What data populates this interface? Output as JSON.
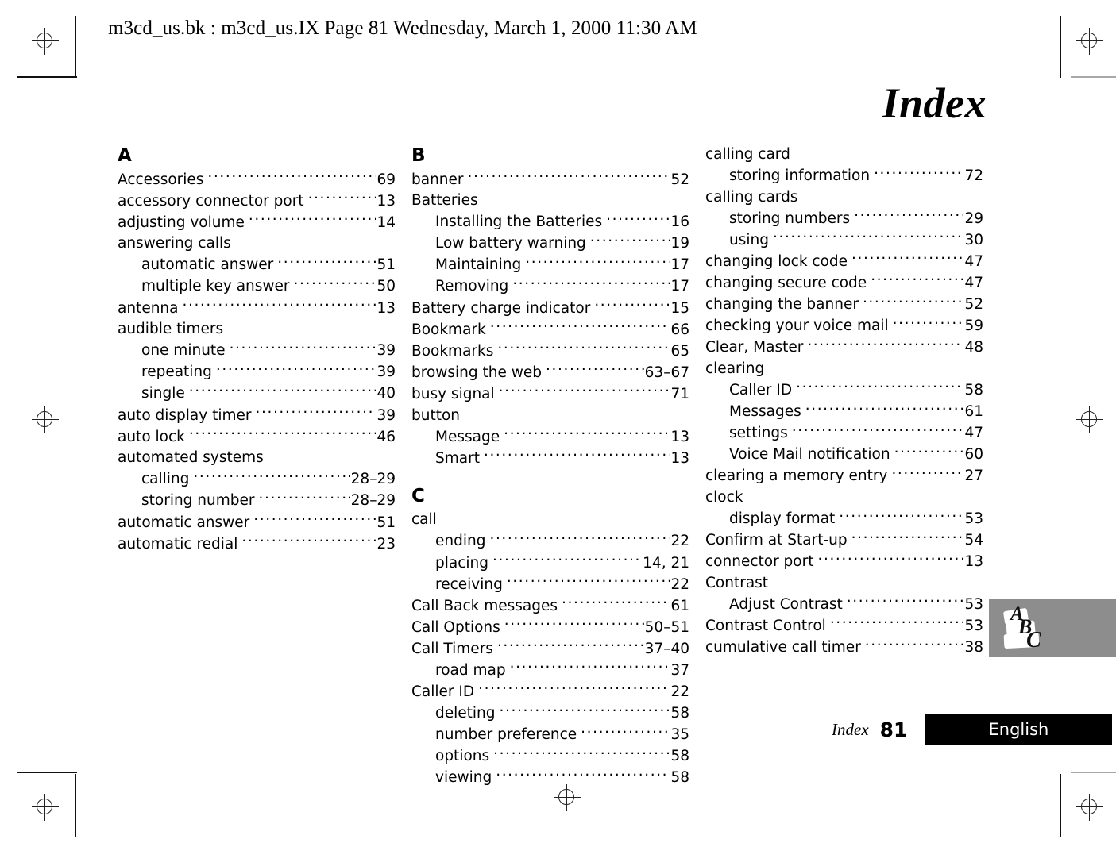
{
  "header": {
    "running_head": "m3cd_us.bk : m3cd_us.IX  Page 81  Wednesday, March 1, 2000  11:30 AM"
  },
  "chapter": {
    "title": "Index"
  },
  "footer": {
    "label": "Index",
    "page_number": "81",
    "language": "English"
  },
  "thumb_tab": {
    "letters": [
      "A",
      "B",
      "C"
    ],
    "background_color": "#8d8d8d"
  },
  "columns": [
    {
      "id": "column-1",
      "blocks": [
        {
          "type": "letter",
          "label": "A"
        },
        {
          "type": "entry",
          "level": 0,
          "term": "Accessories",
          "page": "69"
        },
        {
          "type": "entry",
          "level": 0,
          "term": "accessory connector port",
          "page": "13"
        },
        {
          "type": "entry",
          "level": 0,
          "term": "adjusting volume",
          "page": "14"
        },
        {
          "type": "entry",
          "level": 0,
          "term": "answering calls",
          "page": ""
        },
        {
          "type": "entry",
          "level": 1,
          "term": "automatic answer",
          "page": "51"
        },
        {
          "type": "entry",
          "level": 1,
          "term": "multiple key answer",
          "page": "50"
        },
        {
          "type": "entry",
          "level": 0,
          "term": "antenna",
          "page": "13"
        },
        {
          "type": "entry",
          "level": 0,
          "term": "audible timers",
          "page": ""
        },
        {
          "type": "entry",
          "level": 1,
          "term": "one minute",
          "page": "39"
        },
        {
          "type": "entry",
          "level": 1,
          "term": "repeating",
          "page": "39"
        },
        {
          "type": "entry",
          "level": 1,
          "term": "single",
          "page": "40"
        },
        {
          "type": "entry",
          "level": 0,
          "term": "auto display timer",
          "page": "39"
        },
        {
          "type": "entry",
          "level": 0,
          "term": "auto lock",
          "page": "46"
        },
        {
          "type": "entry",
          "level": 0,
          "term": "automated systems",
          "page": ""
        },
        {
          "type": "entry",
          "level": 1,
          "term": "calling",
          "page": "28–29"
        },
        {
          "type": "entry",
          "level": 1,
          "term": "storing number",
          "page": "28–29"
        },
        {
          "type": "entry",
          "level": 0,
          "term": "automatic answer",
          "page": "51"
        },
        {
          "type": "entry",
          "level": 0,
          "term": "automatic redial",
          "page": "23"
        }
      ]
    },
    {
      "id": "column-2",
      "blocks": [
        {
          "type": "letter",
          "label": "B"
        },
        {
          "type": "entry",
          "level": 0,
          "term": "banner",
          "page": "52"
        },
        {
          "type": "entry",
          "level": 0,
          "term": "Batteries",
          "page": ""
        },
        {
          "type": "entry",
          "level": 1,
          "term": "Installing the Batteries",
          "page": "16"
        },
        {
          "type": "entry",
          "level": 1,
          "term": "Low battery warning",
          "page": "19"
        },
        {
          "type": "entry",
          "level": 1,
          "term": "Maintaining",
          "page": "17"
        },
        {
          "type": "entry",
          "level": 1,
          "term": "Removing",
          "page": "17"
        },
        {
          "type": "entry",
          "level": 0,
          "term": "Battery charge indicator",
          "page": "15"
        },
        {
          "type": "entry",
          "level": 0,
          "term": "Bookmark",
          "page": "66"
        },
        {
          "type": "entry",
          "level": 0,
          "term": "Bookmarks",
          "page": "65"
        },
        {
          "type": "entry",
          "level": 0,
          "term": "browsing the web",
          "page": "63–67"
        },
        {
          "type": "entry",
          "level": 0,
          "term": "busy signal",
          "page": "71"
        },
        {
          "type": "entry",
          "level": 0,
          "term": "button",
          "page": ""
        },
        {
          "type": "entry",
          "level": 1,
          "term": "Message",
          "page": "13"
        },
        {
          "type": "entry",
          "level": 1,
          "term": "Smart",
          "page": "13"
        },
        {
          "type": "letter",
          "label": "C",
          "spaced": true
        },
        {
          "type": "entry",
          "level": 0,
          "term": "call",
          "page": ""
        },
        {
          "type": "entry",
          "level": 1,
          "term": "ending",
          "page": "22"
        },
        {
          "type": "entry",
          "level": 1,
          "term": "placing",
          "page": "14, 21"
        },
        {
          "type": "entry",
          "level": 1,
          "term": "receiving",
          "page": "22"
        },
        {
          "type": "entry",
          "level": 0,
          "term": "Call Back messages",
          "page": "61"
        },
        {
          "type": "entry",
          "level": 0,
          "term": "Call Options",
          "page": "50–51"
        },
        {
          "type": "entry",
          "level": 0,
          "term": "Call Timers",
          "page": "37–40"
        },
        {
          "type": "entry",
          "level": 1,
          "term": "road map",
          "page": "37"
        },
        {
          "type": "entry",
          "level": 0,
          "term": "Caller ID",
          "page": "22"
        },
        {
          "type": "entry",
          "level": 1,
          "term": "deleting",
          "page": "58"
        },
        {
          "type": "entry",
          "level": 1,
          "term": "number preference",
          "page": "35"
        },
        {
          "type": "entry",
          "level": 1,
          "term": "options",
          "page": "58"
        },
        {
          "type": "entry",
          "level": 1,
          "term": "viewing",
          "page": "58"
        }
      ]
    },
    {
      "id": "column-3",
      "blocks": [
        {
          "type": "entry",
          "level": 0,
          "term": "calling card",
          "page": ""
        },
        {
          "type": "entry",
          "level": 1,
          "term": "storing information",
          "page": "72"
        },
        {
          "type": "entry",
          "level": 0,
          "term": "calling cards",
          "page": ""
        },
        {
          "type": "entry",
          "level": 1,
          "term": "storing numbers",
          "page": "29"
        },
        {
          "type": "entry",
          "level": 1,
          "term": "using",
          "page": "30"
        },
        {
          "type": "entry",
          "level": 0,
          "term": "changing lock code",
          "page": "47"
        },
        {
          "type": "entry",
          "level": 0,
          "term": "changing secure code",
          "page": "47"
        },
        {
          "type": "entry",
          "level": 0,
          "term": "changing the banner",
          "page": "52"
        },
        {
          "type": "entry",
          "level": 0,
          "term": "checking your voice mail",
          "page": "59"
        },
        {
          "type": "entry",
          "level": 0,
          "term": "Clear, Master",
          "page": "48"
        },
        {
          "type": "entry",
          "level": 0,
          "term": "clearing",
          "page": ""
        },
        {
          "type": "entry",
          "level": 1,
          "term": "Caller ID",
          "page": "58"
        },
        {
          "type": "entry",
          "level": 1,
          "term": "Messages",
          "page": "61"
        },
        {
          "type": "entry",
          "level": 1,
          "term": "settings",
          "page": "47"
        },
        {
          "type": "entry",
          "level": 1,
          "term": "Voice Mail notification",
          "page": "60"
        },
        {
          "type": "entry",
          "level": 0,
          "term": "clearing a memory entry",
          "page": "27"
        },
        {
          "type": "entry",
          "level": 0,
          "term": "clock",
          "page": ""
        },
        {
          "type": "entry",
          "level": 1,
          "term": "display format",
          "page": "53"
        },
        {
          "type": "entry",
          "level": 0,
          "term": "Confirm at Start-up",
          "page": "54"
        },
        {
          "type": "entry",
          "level": 0,
          "term": "connector port",
          "page": "13"
        },
        {
          "type": "entry",
          "level": 0,
          "term": "Contrast",
          "page": ""
        },
        {
          "type": "entry",
          "level": 1,
          "term": "Adjust Contrast",
          "page": "53"
        },
        {
          "type": "entry",
          "level": 0,
          "term": "Contrast Control",
          "page": "53"
        },
        {
          "type": "entry",
          "level": 0,
          "term": "cumulative call timer",
          "page": "38"
        }
      ]
    }
  ]
}
